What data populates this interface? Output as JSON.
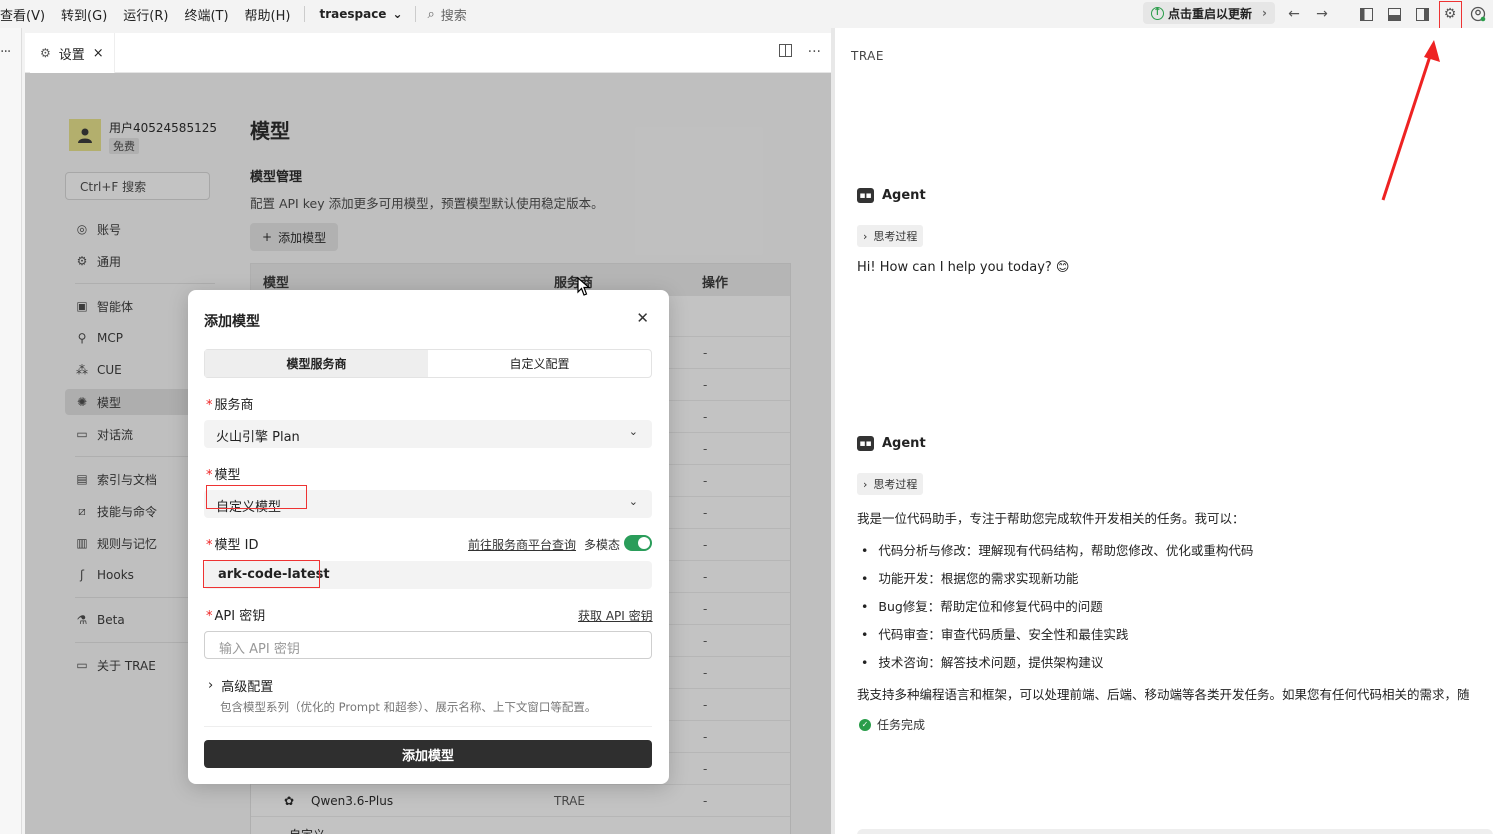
{
  "menubar": {
    "items": [
      "查看(V)",
      "转到(G)",
      "运行(R)",
      "终端(T)",
      "帮助(H)"
    ],
    "workspace": "traespace",
    "search_placeholder": "搜索",
    "update_button": "点击重启以更新"
  },
  "tab": {
    "label": "设置"
  },
  "settings": {
    "user_name": "用户40524585125",
    "plan_badge": "免费",
    "search_placeholder": "Ctrl+F 搜索",
    "nav": [
      {
        "label": "账号",
        "icon": "account-icon"
      },
      {
        "label": "通用",
        "icon": "gear-icon"
      },
      {
        "label": "智能体",
        "icon": "agent-icon"
      },
      {
        "label": "MCP",
        "icon": "mcp-icon"
      },
      {
        "label": "CUE",
        "icon": "cue-icon"
      },
      {
        "label": "模型",
        "icon": "model-icon"
      },
      {
        "label": "对话流",
        "icon": "chat-flow-icon"
      },
      {
        "label": "索引与文档",
        "icon": "index-icon"
      },
      {
        "label": "技能与命令",
        "icon": "skills-icon"
      },
      {
        "label": "规则与记忆",
        "icon": "rules-icon"
      },
      {
        "label": "Hooks",
        "icon": "hooks-icon"
      },
      {
        "label": "Beta",
        "icon": "beta-icon"
      },
      {
        "label": "关于 TRAE",
        "icon": "about-icon"
      }
    ],
    "page_title": "模型",
    "section_title": "模型管理",
    "section_desc": "配置 API key 添加更多可用模型，预置模型默认使用稳定版本。",
    "add_model_label": "添加模型",
    "table_headers": [
      "模型",
      "服务商",
      "操作"
    ],
    "visible_row": {
      "model": "Qwen3.6-Plus",
      "provider": "TRAE",
      "action": "-"
    },
    "row_action": "-",
    "custom_row": "自定义"
  },
  "modal": {
    "title": "添加模型",
    "segments": [
      "模型服务商",
      "自定义配置"
    ],
    "provider_label": "服务商",
    "provider_value": "火山引擎 Plan",
    "model_label": "模型",
    "model_value": "自定义模型",
    "model_id_label": "模型 ID",
    "model_id_link": "前往服务商平台查询",
    "multimodal_label": "多模态",
    "multimodal_on": true,
    "model_id_value": "ark-code-latest",
    "api_label": "API 密钥",
    "api_link": "获取 API 密钥",
    "api_placeholder": "输入 API 密钥",
    "advanced_label": "高级配置",
    "advanced_desc": "包含模型系列（优化的 Prompt 和超参）、展示名称、上下文窗口等配置。",
    "submit_label": "添加模型"
  },
  "chat": {
    "title": "TRAE",
    "agent_label": "Agent",
    "think_label": "思考过程",
    "greeting": "Hi! How can I help you today? 😊",
    "intro": "我是一位代码助手，专注于帮助您完成软件开发相关的任务。我可以：",
    "bullets": [
      "代码分析与修改：理解现有代码结构，帮助您修改、优化或重构代码",
      "功能开发：根据您的需求实现新功能",
      "Bug修复：帮助定位和修复代码中的问题",
      "代码审查：审查代码质量、安全性和最佳实践",
      "技术咨询：解答技术问题，提供架构建议"
    ],
    "outro": "我支持多种编程语言和框架，可以处理前端、后端、移动端等各类开发任务。如果您有任何代码相关的需求，随",
    "status": "任务完成"
  }
}
